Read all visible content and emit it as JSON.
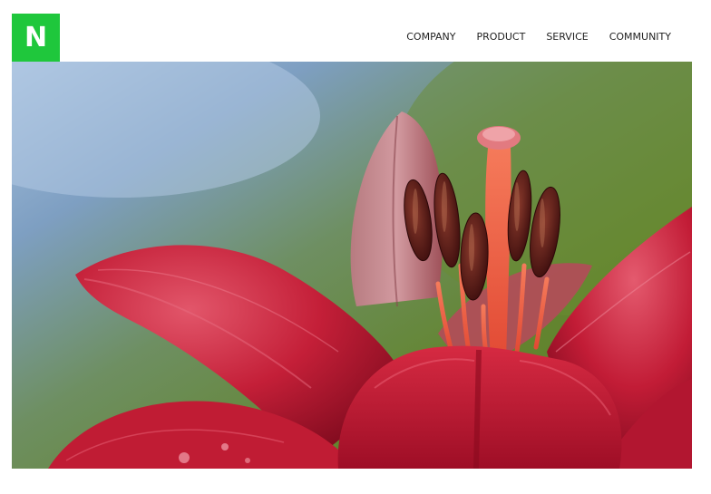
{
  "brand": {
    "logo_letter": "N",
    "logo_color": "#1fc73c"
  },
  "nav": {
    "items": [
      {
        "id": "company",
        "label": "COMPANY"
      },
      {
        "id": "product",
        "label": "PRODUCT"
      },
      {
        "id": "service",
        "label": "SERVICE"
      },
      {
        "id": "community",
        "label": "COMMUNITY"
      }
    ]
  },
  "hero": {
    "subject": "red-lily-flower-photo",
    "colors": {
      "petal": "#c8203a",
      "petal_dark": "#7a0a1c",
      "stamen": "#f25a3c",
      "anther": "#5a1a16",
      "background_sky": "#9fbad8",
      "background_leaf": "#6a8a3c"
    }
  }
}
